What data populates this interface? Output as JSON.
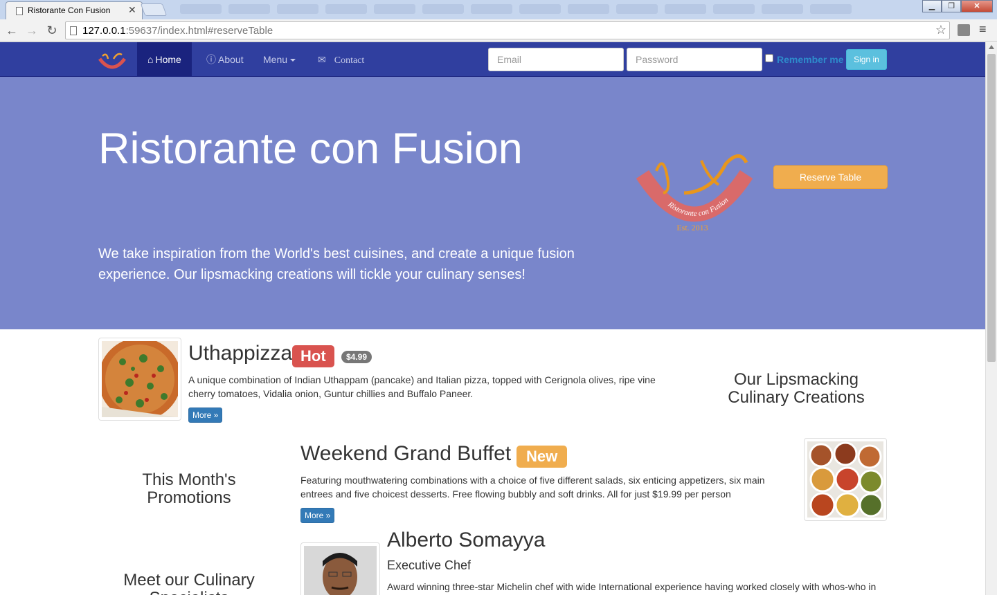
{
  "browser": {
    "tab_title": "Ristorante Con Fusion",
    "tab_close": "✕",
    "url_host": "127.0.0.1",
    "url_rest": ":59637/index.html#reserveTable",
    "window_buttons": {
      "minimize": "▁",
      "maximize": "❐",
      "close": "✕"
    }
  },
  "navbar": {
    "items": [
      {
        "label": "Home",
        "icon": "home-icon",
        "active": true
      },
      {
        "label": "About",
        "icon": "info-icon"
      },
      {
        "label": "Menu",
        "icon": "caret-down-icon"
      },
      {
        "label": "Contact",
        "icon": "envelope-icon"
      }
    ],
    "email_placeholder": "Email",
    "password_placeholder": "Password",
    "remember_label": "Remember me",
    "signin_label": "Sign in"
  },
  "jumbotron": {
    "title": "Ristorante con Fusion",
    "text": "We take inspiration from the World's best cuisines, and create a unique fusion experience. Our lipsmacking creations will tickle your culinary senses!",
    "logo_text": "Ristorante con Fusion",
    "logo_est": "Est. 2013",
    "reserve_label": "Reserve Table"
  },
  "dishes": {
    "uthappizza": {
      "name": "Uthappizza",
      "label": "Hot",
      "price": "$4.99",
      "description": "A unique combination of Indian Uthappam (pancake) and Italian pizza, topped with Cerignola olives, ripe vine cherry tomatoes, Vidalia onion, Guntur chillies and Buffalo Paneer.",
      "more": "More »"
    },
    "buffet": {
      "name": "Weekend Grand Buffet",
      "label": "New",
      "description": "Featuring mouthwatering combinations with a choice of five different salads, six enticing appetizers, six main entrees and five choicest desserts. Free flowing bubbly and soft drinks. All for just $19.99 per person",
      "more": "More »"
    },
    "chef": {
      "name": "Alberto Somayya",
      "title": "Executive Chef",
      "description": "Award winning three-star Michelin chef with wide International experience having worked closely with whos-who in"
    }
  },
  "sections": {
    "creations": "Our Lipsmacking Culinary Creations",
    "promotions": "This Month's Promotions",
    "specialists": "Meet our Culinary Specialists"
  },
  "colors": {
    "navbar": "#303f9f",
    "navbar_active": "#1a237e",
    "jumbotron": "#7986cb",
    "reserve_button": "#f0ad4e",
    "signin_button": "#5bc0de",
    "label_hot": "#d9534f",
    "label_new": "#f0ad4e",
    "more_button": "#337ab7"
  }
}
